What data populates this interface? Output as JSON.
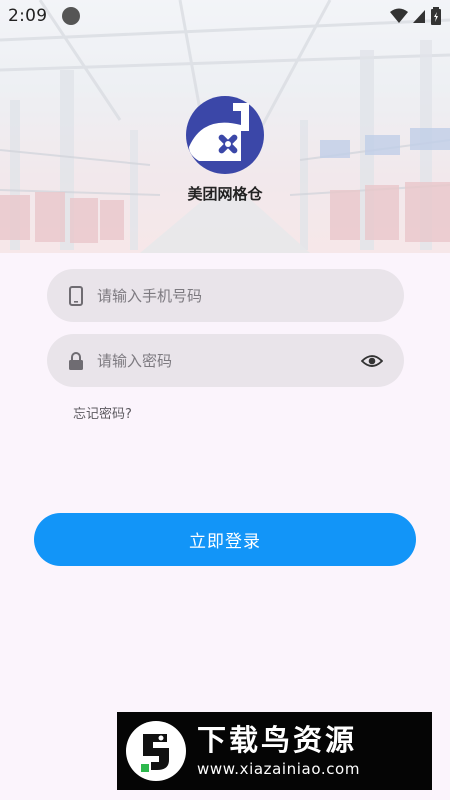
{
  "status_bar": {
    "time": "2:09"
  },
  "header": {
    "app_name": "美团网格仓",
    "logo_icon": "meituan-grid-warehouse-logo",
    "background": "warehouse-photo"
  },
  "form": {
    "phone": {
      "placeholder": "请输入手机号码",
      "value": "",
      "icon": "phone-icon"
    },
    "password": {
      "placeholder": "请输入密码",
      "value": "",
      "icon": "lock-icon",
      "toggle_icon": "eye-icon"
    },
    "forgot_label": "忘记密码?",
    "login_label": "立即登录"
  },
  "watermark": {
    "title": "下载鸟资源",
    "url": "www.xiazainiao.com"
  },
  "colors": {
    "accent": "#1295f8",
    "logo_blue": "#3b47a8",
    "field_bg": "#e9e4ea",
    "page_bg": "#fbf4fc"
  }
}
